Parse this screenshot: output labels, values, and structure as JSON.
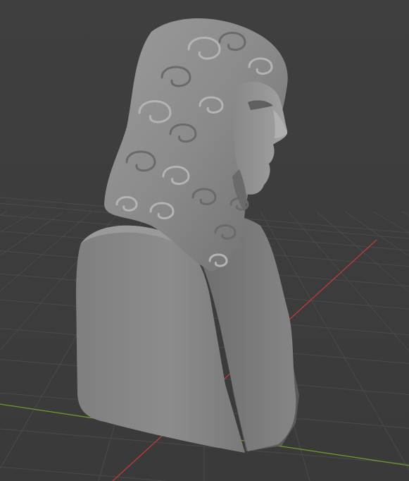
{
  "viewport": {
    "background_color": "#3d3d3d",
    "grid_color": "#4a4a4a",
    "x_axis_color": "#c2393a",
    "y_axis_color": "#6c9a2c",
    "object_color": "#8a8a8a",
    "object_highlight_color": "#a8a8a8",
    "object_shadow_color": "#5e5e5e",
    "grid_visible": true,
    "object_name": "sculpted-bust"
  }
}
